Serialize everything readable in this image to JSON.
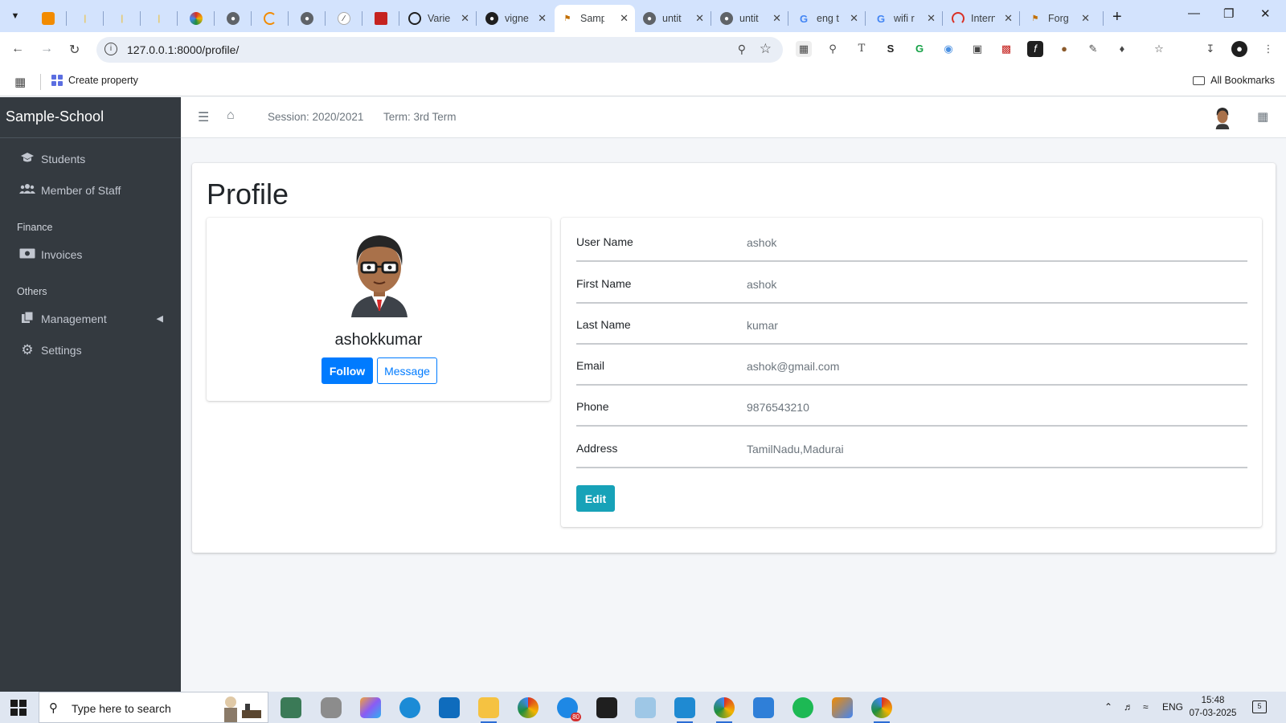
{
  "browser": {
    "tabs": [
      {
        "title": "",
        "favicon": "overflow-menu-icon",
        "color": "#1f1f1f"
      },
      {
        "title": "",
        "favicon": "orange-tab-icon",
        "color": "#f28b00"
      },
      {
        "title": "",
        "favicon": "yellow-tab-icon",
        "color": "#f4b400"
      },
      {
        "title": "",
        "favicon": "yellow-tab-icon",
        "color": "#f4b400"
      },
      {
        "title": "",
        "favicon": "yellow-tab-icon",
        "color": "#f4b400"
      },
      {
        "title": "",
        "favicon": "colorful-tab-icon",
        "color": "#d93025"
      },
      {
        "title": "",
        "favicon": "globe-icon",
        "color": "#5f6368"
      },
      {
        "title": "",
        "favicon": "loading-icon",
        "color": "#f28b00"
      },
      {
        "title": "",
        "favicon": "globe-icon",
        "color": "#5f6368"
      },
      {
        "title": "",
        "favicon": "zap-icon",
        "color": "#1f1f1f"
      },
      {
        "title": "",
        "favicon": "red-tab-icon",
        "color": "#c5221f"
      },
      {
        "title": "Varie",
        "favicon": "circle-icon",
        "color": "#1f1f1f"
      },
      {
        "title": "vigne",
        "favicon": "github-icon",
        "color": "#1f1f1f"
      },
      {
        "title": "Samp",
        "favicon": "school-icon",
        "color": "#c26f00"
      },
      {
        "title": "untit",
        "favicon": "globe-icon",
        "color": "#5f6368"
      },
      {
        "title": "untit",
        "favicon": "globe-icon",
        "color": "#5f6368"
      },
      {
        "title": "eng t",
        "favicon": "google-icon",
        "color": "#4285f4"
      },
      {
        "title": "wifi r",
        "favicon": "google-icon",
        "color": "#4285f4"
      },
      {
        "title": "Intern",
        "favicon": "speedometer-icon",
        "color": "#d93025"
      },
      {
        "title": "Forg",
        "favicon": "school-icon",
        "color": "#c26f00"
      }
    ],
    "url": "127.0.0.1:8000/profile/",
    "bookmark": "Create property",
    "all_bookmarks": "All Bookmarks"
  },
  "sidebar": {
    "brand": "Sample-School",
    "items": [
      {
        "label": "Students",
        "icon": "graduation-cap-icon"
      },
      {
        "label": "Member of Staff",
        "icon": "users-icon"
      }
    ],
    "finance_header": "Finance",
    "finance_items": [
      {
        "label": "Invoices",
        "icon": "money-bill-icon"
      }
    ],
    "others_header": "Others",
    "others_items": [
      {
        "label": "Management",
        "icon": "copy-icon"
      },
      {
        "label": "Settings",
        "icon": "gear-icon"
      }
    ]
  },
  "navbar": {
    "session": "Session: 2020/2021",
    "term": "Term: 3rd Term"
  },
  "profile": {
    "page_title": "Profile",
    "username_display": "ashokkumar",
    "follow_label": "Follow",
    "message_label": "Message",
    "fields": [
      {
        "label": "User Name",
        "value": "ashok"
      },
      {
        "label": "First Name",
        "value": "ashok"
      },
      {
        "label": "Last Name",
        "value": "kumar"
      },
      {
        "label": "Email",
        "value": "ashok@gmail.com"
      },
      {
        "label": "Phone",
        "value": "9876543210"
      },
      {
        "label": "Address",
        "value": "TamilNadu,Madurai"
      }
    ],
    "edit_label": "Edit"
  },
  "taskbar": {
    "search_placeholder": "Type here to search",
    "language": "ENG",
    "time": "15:48",
    "date": "07-03-2025",
    "notification_count": "5",
    "badge": "80"
  },
  "colors": {
    "sidebar_bg": "#343a40",
    "primary": "#007bff",
    "info": "#17a2b8",
    "browser_frame": "#d3e3fd"
  }
}
